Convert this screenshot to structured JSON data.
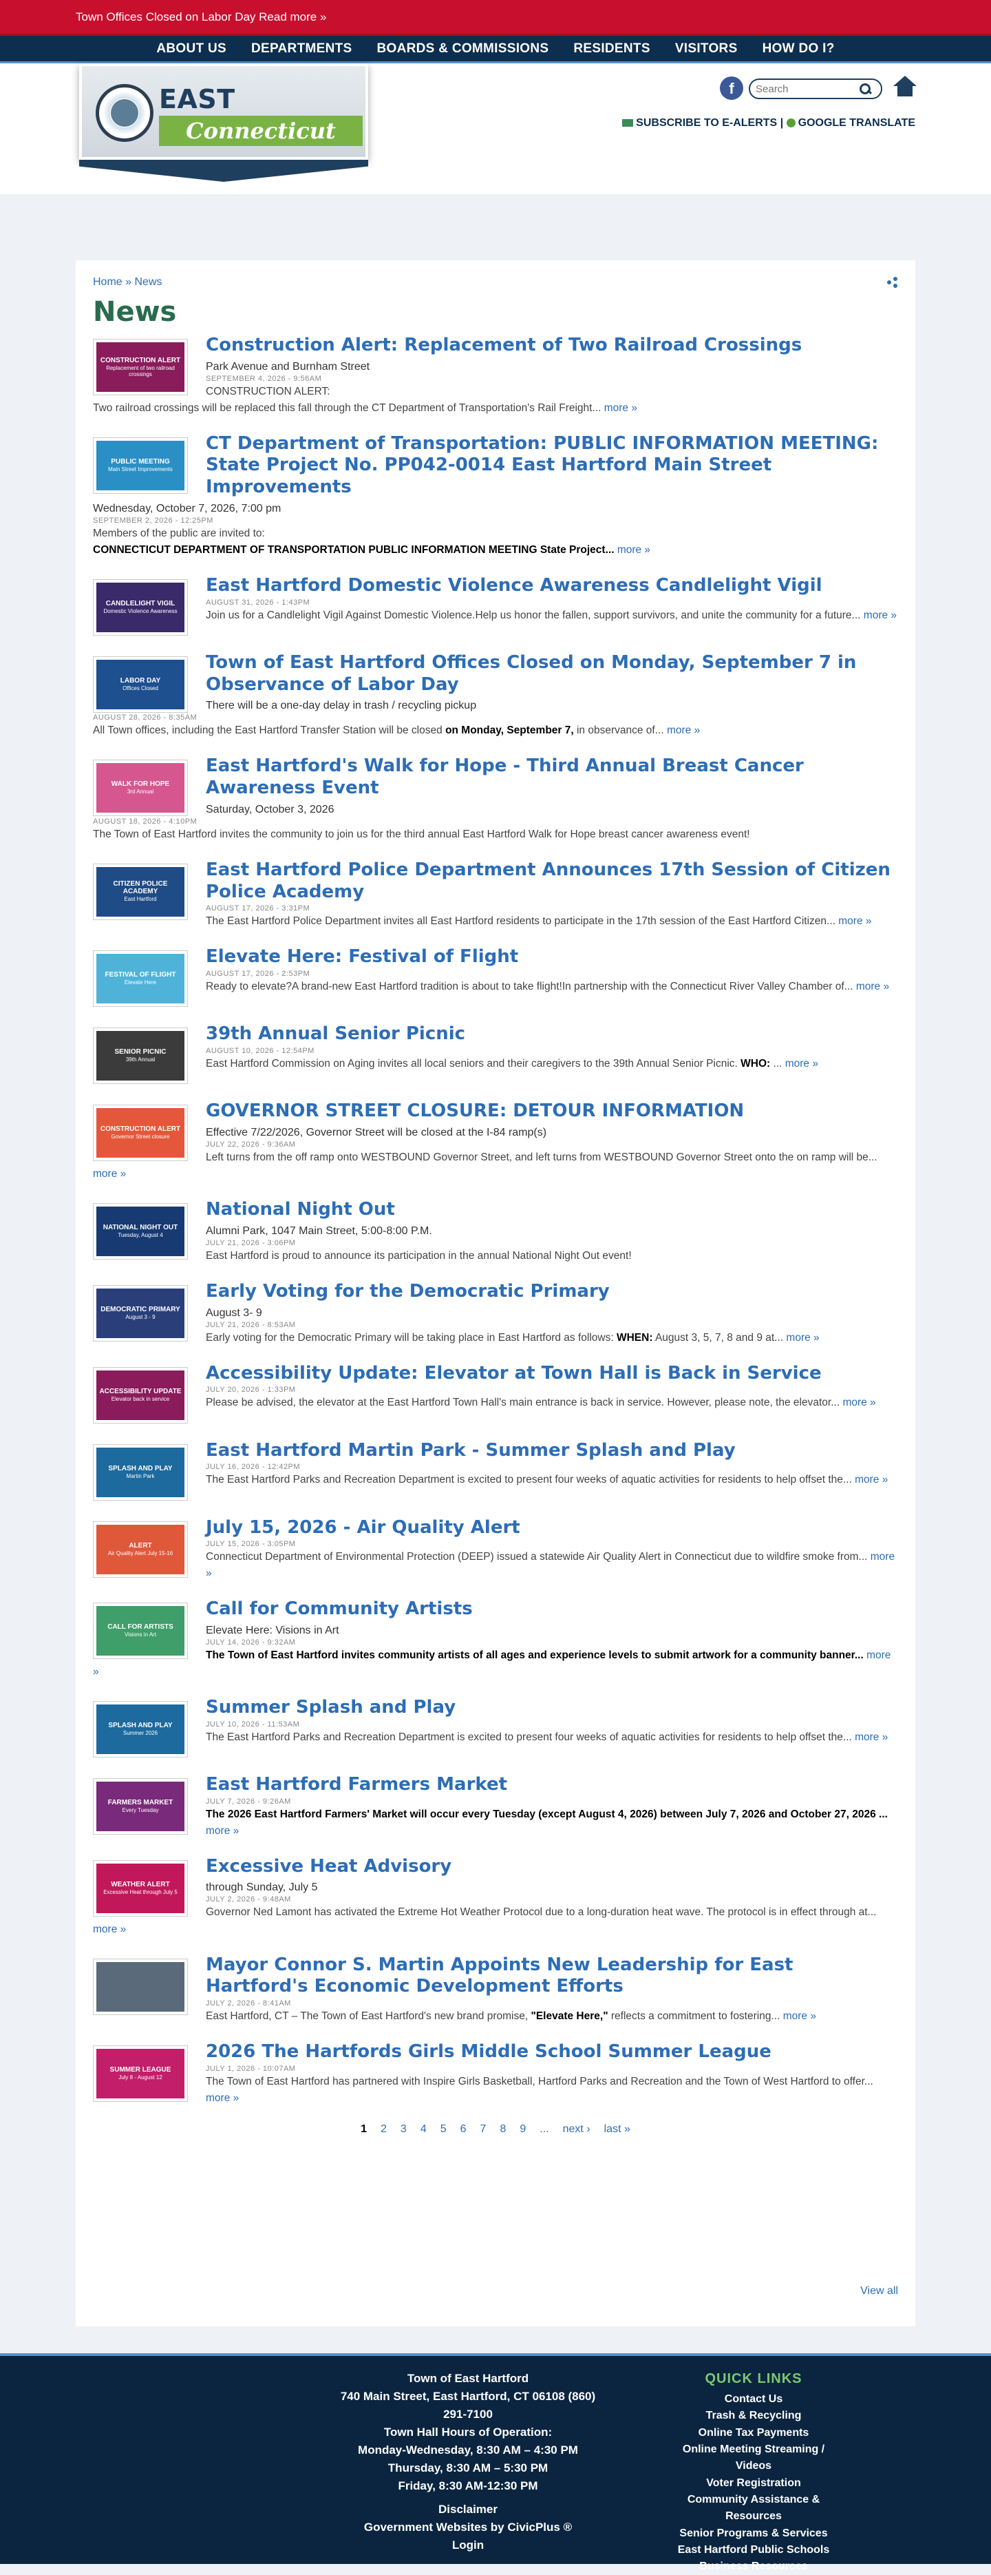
{
  "alert": {
    "text": "Town Offices Closed on Labor Day Read more »"
  },
  "nav": [
    "ABOUT US",
    "DEPARTMENTS",
    "BOARDS & COMMISSIONS",
    "RESIDENTS",
    "VISITORS",
    "HOW DO I?"
  ],
  "header": {
    "logo_title": "EAST HARTFORD",
    "logo_sub": "Connecticut",
    "search_placeholder": "Search",
    "subscribe": "SUBSCRIBE TO E-ALERTS",
    "separator": "|",
    "translate": "GOOGLE TRANSLATE",
    "facebook": "f"
  },
  "breadcrumb": {
    "home": "Home",
    "sep": " » ",
    "current": "News"
  },
  "page_title": "News",
  "news": [
    {
      "title": "Construction Alert: Replacement of Two Railroad Crossings",
      "sub": "Park Avenue and Burnham Street",
      "date": "SEPTEMBER 4, 2026 - 9:56AM",
      "desc": "CONSTRUCTION ALERT:",
      "desc2": "Two railroad crossings will be replaced this fall through the CT Department of Transportation's Rail Freight...",
      "more": "more »",
      "thumb": {
        "bg": "#8a1c5c",
        "title": "CONSTRUCTION ALERT",
        "text": "Replacement of two railroad crossings"
      }
    },
    {
      "title": "CT Department of Transportation: PUBLIC INFORMATION MEETING: State Project No. PP042-0014 East Hartford Main Street Improvements",
      "sub": "Wednesday, October 7, 2026, 7:00 pm",
      "date": "SEPTEMBER 2, 2026 - 12:25PM",
      "desc": "Members of the public are invited to:",
      "desc_bold": "CONNECTICUT DEPARTMENT OF TRANSPORTATION PUBLIC INFORMATION MEETING State Project...",
      "more": "more »",
      "thumb": {
        "bg": "#2a8fc4",
        "title": "PUBLIC MEETING",
        "text": "Main Street Improvements"
      }
    },
    {
      "title": "East Hartford Domestic Violence Awareness Candlelight Vigil",
      "date": "AUGUST 31, 2026 - 1:43PM",
      "desc": "Join us for a Candlelight Vigil Against Domestic Violence.Help us honor the fallen, support survivors, and unite the community for a future...",
      "more": "more »",
      "thumb": {
        "bg": "#3a2a6a",
        "title": "CANDLELIGHT VIGIL",
        "text": "Domestic Violence Awareness"
      }
    },
    {
      "title": "Town of East Hartford Offices Closed on Monday, September 7 in Observance of Labor Day",
      "sub": "There will be a one-day delay in trash / recycling pickup",
      "date": "AUGUST 28, 2026 - 8:35AM",
      "desc": "All Town offices, including the East Hartford Transfer Station will be closed",
      "desc_bold": "on Monday, September 7,",
      "desc3": "in observance of...",
      "more": "more »",
      "thumb": {
        "bg": "#1e4f8f",
        "title": "LABOR DAY",
        "text": "Offices Closed"
      }
    },
    {
      "title": "East Hartford's Walk for Hope - Third Annual Breast Cancer Awareness Event",
      "sub": "Saturday, October 3, 2026",
      "date": "AUGUST 18, 2026 - 4:10PM",
      "desc": "The Town of East Hartford invites the community to join us for the third annual East Hartford Walk for Hope breast cancer awareness event!",
      "thumb": {
        "bg": "#d6578f",
        "title": "WALK FOR HOPE",
        "text": "3rd Annual"
      }
    },
    {
      "title": "East Hartford Police Department Announces 17th Session of Citizen Police Academy",
      "date": "AUGUST 17, 2026 - 3:31PM",
      "desc": "The East Hartford Police Department invites all East Hartford residents to participate in the 17th session of the East Hartford Citizen...",
      "more": "more »",
      "thumb": {
        "bg": "#1f4c86",
        "title": "CITIZEN POLICE ACADEMY",
        "text": "East Hartford"
      }
    },
    {
      "title": "Elevate Here: Festival of Flight",
      "date": "AUGUST 17, 2026 - 2:53PM",
      "desc": "Ready to elevate?A brand-new East Hartford tradition is about to take flight!In partnership with the Connecticut River Valley Chamber of...",
      "more": "more »",
      "thumb": {
        "bg": "#4fb3d9",
        "title": "FESTIVAL OF FLIGHT",
        "text": "Elevate Here"
      }
    },
    {
      "title": "39th Annual Senior Picnic",
      "date": "AUGUST 10, 2026 - 12:54PM",
      "desc": "East Hartford Commission on Aging invites all local seniors and their caregivers to the 39th Annual Senior Picnic.",
      "desc_bold": "WHO:",
      "desc3": "...",
      "more": "more »",
      "thumb": {
        "bg": "#3b3b3b",
        "title": "SENIOR PICNIC",
        "text": "39th Annual"
      }
    },
    {
      "title": "GOVERNOR STREET CLOSURE: DETOUR INFORMATION",
      "sub": "Effective 7/22/2026, Governor Street will be closed at the I-84 ramp(s)",
      "date": "JULY 22, 2026 - 9:36AM",
      "desc": "Left turns from the off ramp onto WESTBOUND Governor Street, and left turns from WESTBOUND Governor Street onto the on ramp will be...",
      "more": "more »",
      "thumb": {
        "bg": "#e5573a",
        "title": "CONSTRUCTION ALERT",
        "text": "Governor Street closure"
      }
    },
    {
      "title": "National Night Out",
      "sub": "Alumni Park, 1047 Main Street, 5:00-8:00 P.M.",
      "date": "JULY 21, 2026 - 3:06PM",
      "desc": "East Hartford is proud to announce its participation in the annual National Night Out event!",
      "thumb": {
        "bg": "#173a73",
        "title": "NATIONAL NIGHT OUT",
        "text": "Tuesday, August 4"
      }
    },
    {
      "title": "Early Voting for the Democratic Primary",
      "sub": "August 3- 9",
      "date": "JULY 21, 2026 - 8:53AM",
      "desc": "Early voting for the Democratic Primary will be taking place in East Hartford as follows:",
      "desc_bold": "WHEN:",
      "desc3": "August 3, 5, 7, 8 and 9 at...",
      "more": "more »",
      "thumb": {
        "bg": "#2a3f7a",
        "title": "DEMOCRATIC PRIMARY",
        "text": "August 3 - 9"
      }
    },
    {
      "title": "Accessibility Update: Elevator at Town Hall is Back in Service",
      "date": "JULY 20, 2026 - 1:33PM",
      "desc": "Please be advised, the elevator at the East Hartford Town Hall's main entrance is back in service. However, please note, the elevator...",
      "more": "more »",
      "thumb": {
        "bg": "#8a1c5c",
        "title": "ACCESSIBILITY UPDATE",
        "text": "Elevator back in service"
      }
    },
    {
      "title": "East Hartford Martin Park - Summer Splash and Play",
      "date": "JULY 16, 2026 - 12:42PM",
      "desc": "The East Hartford Parks and Recreation Department is excited to present four weeks of aquatic activities for residents to help offset the...",
      "more": "more »",
      "thumb": {
        "bg": "#1c6a9e",
        "title": "SPLASH AND PLAY",
        "text": "Martin Park"
      }
    },
    {
      "title": "July 15, 2026 - Air Quality Alert",
      "date": "JULY 15, 2026 - 3:05PM",
      "desc": "Connecticut Department of Environmental Protection (DEEP) issued a statewide Air Quality Alert in Connecticut due to wildfire smoke from...",
      "more": "more »",
      "thumb": {
        "bg": "#e0583a",
        "title": "ALERT",
        "text": "Air Quality Alert July 15-16"
      }
    },
    {
      "title": "Call for Community Artists",
      "sub": "Elevate Here: Visions in Art",
      "date": "JULY 14, 2026 - 9:32AM",
      "desc_bold": "The Town of East Hartford invites community artists of all ages and experience levels to submit artwork for a community banner...",
      "more": "more »",
      "thumb": {
        "bg": "#3f9e6a",
        "title": "CALL FOR ARTISTS",
        "text": "Visions in Art"
      }
    },
    {
      "title": "Summer Splash and Play",
      "date": "JULY 10, 2026 - 11:53AM",
      "desc": "The East Hartford Parks and Recreation Department is excited to present four weeks of aquatic activities for residents to help offset the...",
      "more": "more »",
      "thumb": {
        "bg": "#1c6a9e",
        "title": "SPLASH AND PLAY",
        "text": "Summer 2026"
      }
    },
    {
      "title": "East Hartford Farmers Market",
      "date": "JULY 7, 2026 - 9:26AM",
      "desc_bold": "The 2026 East Hartford Farmers' Market will occur every Tuesday (except August 4, 2026) between July 7, 2026 and October 27, 2026 ...",
      "more": "more »",
      "thumb": {
        "bg": "#7a2a7a",
        "title": "FARMERS MARKET",
        "text": "Every Tuesday"
      }
    },
    {
      "title": "Excessive Heat Advisory",
      "sub": "through Sunday, July 5",
      "date": "JULY 2, 2026 - 9:48AM",
      "desc": "Governor Ned Lamont has activated the Extreme Hot Weather Protocol due to a long-duration heat wave. The protocol is in effect through at...",
      "more": "more »",
      "thumb": {
        "bg": "#c2185b",
        "title": "WEATHER ALERT",
        "text": "Excessive Heat through July 5"
      }
    },
    {
      "title": "Mayor Connor S. Martin Appoints New Leadership for East Hartford's Economic Development Efforts",
      "date": "JULY 2, 2026 - 8:41AM",
      "desc": "East Hartford, CT – The Town of East Hartford's new brand promise,",
      "desc_bold": "\"Elevate Here,\"",
      "desc3": "reflects a commitment to fostering...",
      "more": "more »",
      "thumb": {
        "bg": "#5a6a7a",
        "title": "",
        "text": ""
      }
    },
    {
      "title": "2026 The Hartfords Girls Middle School Summer League",
      "date": "JULY 1, 2026 - 10:07AM",
      "desc": "The Town of East Hartford has partnered with Inspire Girls Basketball, Hartford Parks and Recreation and the Town of West Hartford to offer...",
      "more": "more »",
      "thumb": {
        "bg": "#c21e6a",
        "title": "SUMMER LEAGUE",
        "text": "July 8 - August 12"
      }
    }
  ],
  "pager": {
    "pages": [
      "1",
      "2",
      "3",
      "4",
      "5",
      "6",
      "7",
      "8",
      "9",
      "...",
      "next ›",
      "last »"
    ],
    "current": "1",
    "view_all": "View all"
  },
  "footer": {
    "org": "Town of East Hartford",
    "address": "740 Main Street, East Hartford, CT 06108  (860)",
    "phone": "291-7100",
    "hours_title": "Town Hall Hours of Operation:",
    "hours1": "Monday-Wednesday, 8:30 AM – 4:30 PM",
    "hours2": "Thursday, 8:30 AM – 5:30 PM",
    "hours3": "Friday, 8:30 AM-12:30 PM",
    "disclaimer": "Disclaimer",
    "civicplus": "Government Websites by CivicPlus ®",
    "login": "Login",
    "quick_title": "QUICK LINKS",
    "quick_links": [
      "Contact Us",
      "Trash & Recycling",
      "Online Tax Payments",
      "Online Meeting Streaming / Videos",
      "Voter Registration",
      "Community Assistance & Resources",
      "Senior Programs & Services",
      "East Hartford Public Schools",
      "Business Resources"
    ]
  }
}
